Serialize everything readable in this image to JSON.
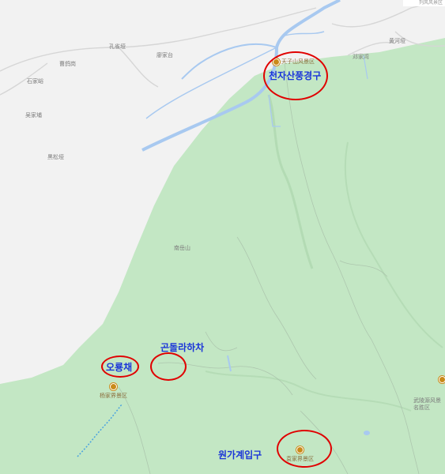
{
  "map": {
    "colors": {
      "land": "#f2f2f2",
      "forest": "#c3e7c4",
      "water": "#a8c9f0",
      "road": "#d8d8d8",
      "annotation_ring": "#e00000",
      "annotation_text": "#1a35d8"
    },
    "corner_label": "列风风景区",
    "place_labels": [
      {
        "id": "kongxinya",
        "text": "孔雀垭"
      },
      {
        "id": "liaojiatai",
        "text": "廖家台"
      },
      {
        "id": "caojiagang",
        "text": "曹鸽岗"
      },
      {
        "id": "shijiaqi",
        "text": "石家峪"
      },
      {
        "id": "wujiapu",
        "text": "吴家埔"
      },
      {
        "id": "heisongya",
        "text": "黑松垭"
      },
      {
        "id": "dengjiawan",
        "text": "邓家湾"
      },
      {
        "id": "huanghe",
        "text": "黄河垭"
      },
      {
        "id": "nanshan",
        "text": "南岳山"
      },
      {
        "id": "wulingyuan",
        "text": "武陵源风景名胜区"
      }
    ],
    "pois": [
      {
        "id": "tianzishan",
        "text": "天子山风景区",
        "icon": "scenic-area-icon"
      },
      {
        "id": "yangjiajie",
        "text": "杨家界景区",
        "icon": "scenic-area-icon"
      },
      {
        "id": "yuanjiajie",
        "text": "袁家界景区",
        "icon": "scenic-area-icon"
      }
    ],
    "annotations": [
      {
        "id": "tianzishan",
        "text": "천자산풍경구"
      },
      {
        "id": "wulongzhai",
        "text": "오룡채"
      },
      {
        "id": "gondola",
        "text": "곤돌라하차"
      },
      {
        "id": "yuanjiajie",
        "text": "원가계입구"
      }
    ]
  }
}
